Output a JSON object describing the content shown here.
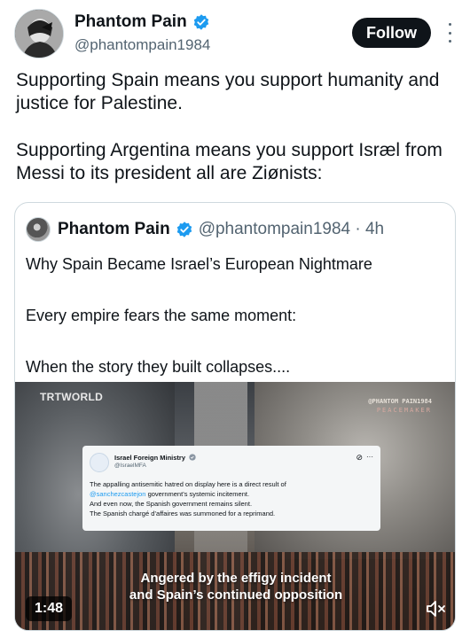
{
  "author": {
    "display_name": "Phantom Pain",
    "handle": "@phantompain1984"
  },
  "follow_label": "Follow",
  "tweet": {
    "paragraph_1": "Supporting Spain means you support humanity and justice for Palestine.",
    "paragraph_2": "Supporting Argentina means you support Isræl from Messi to its president all are Ziønists:"
  },
  "quote": {
    "display_name": "Phantom Pain",
    "handle_time": "@phantompain1984 · 4h",
    "lines": [
      "Why Spain Became Israel’s European Nightmare",
      "Every empire fears the same moment:",
      "When the story they built collapses...."
    ]
  },
  "video": {
    "brand": "TRTWORLD",
    "watermark_line_1": "@PHANTOM PAIN1984",
    "watermark_line_2": "PEACEMAKER",
    "duration": "1:48",
    "caption_line_1": "Angered by the effigy incident",
    "caption_line_2": "and Spain’s continued opposition",
    "embedded_post": {
      "name": "Israel Foreign Ministry",
      "handle": "@IsraelMFA",
      "text_line_1": "The appalling antisemitic hatred on display here is a direct result of",
      "mention": "@sanchezcastejon",
      "text_line_2_rest": " government’s systemic incitement.",
      "text_line_3": "And even now, the Spanish government remains silent.",
      "text_line_4": "The Spanish chargé d’affaires was summoned for a reprimand."
    }
  },
  "colors": {
    "verified_blue": "#1d9bf0",
    "text_primary": "#0f1419",
    "text_secondary": "#536471",
    "border": "#cfd9de"
  },
  "icons": [
    "verified-badge-icon",
    "more-options-icon",
    "mute-icon",
    "grok-icon"
  ]
}
